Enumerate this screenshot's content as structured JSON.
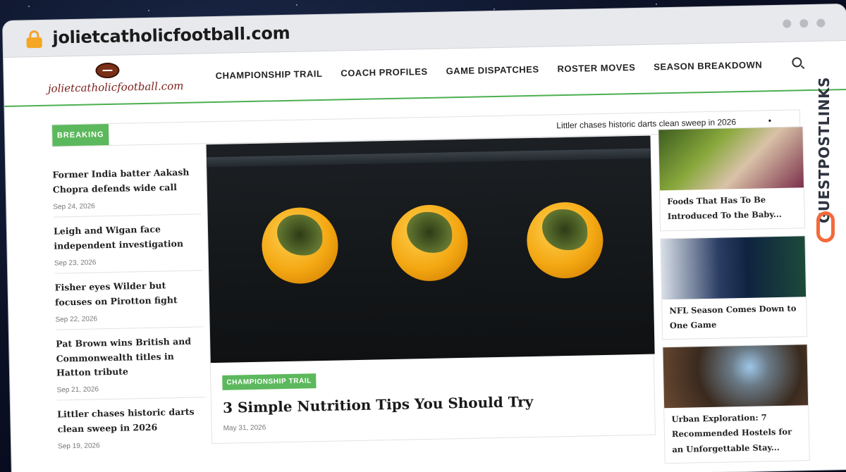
{
  "browser": {
    "url": "jolietcatholicfootball.com"
  },
  "site": {
    "logo_text": "jolietcatholicfootball.com",
    "nav": [
      "CHAMPIONSHIP TRAIL",
      "COACH PROFILES",
      "GAME DISPATCHES",
      "ROSTER MOVES",
      "SEASON BREAKDOWN"
    ]
  },
  "breaking": {
    "label": "BREAKING",
    "ticker": "Littler chases historic darts clean sweep in 2026",
    "dot": "•"
  },
  "left_list": [
    {
      "title": "Former India batter Aakash Chopra defends wide call reversal against",
      "date": "Sep 24, 2026"
    },
    {
      "title": "Leigh and Wigan face independent investigation",
      "date": "Sep 23, 2026"
    },
    {
      "title": "Fisher eyes Wilder but focuses on Pirotton fight",
      "date": "Sep 22, 2026"
    },
    {
      "title": "Pat Brown wins British and Commonwealth titles in Hatton tribute",
      "date": "Sep 21, 2026"
    },
    {
      "title": "Littler chases historic darts clean sweep in 2026",
      "date": "Sep 19, 2026"
    }
  ],
  "hero": {
    "category": "CHAMPIONSHIP TRAIL",
    "title": "3 Simple Nutrition Tips You Should Try",
    "date": "May 31, 2026"
  },
  "right_cards": [
    {
      "title": "Foods That Has To Be Introduced To the Baby..."
    },
    {
      "title": "NFL Season Comes Down to One Game"
    },
    {
      "title": "Urban Exploration: 7 Recommended Hostels for an Unforgettable Stay..."
    }
  ],
  "watermark": {
    "text": "GUESTPOSTLINKS"
  }
}
